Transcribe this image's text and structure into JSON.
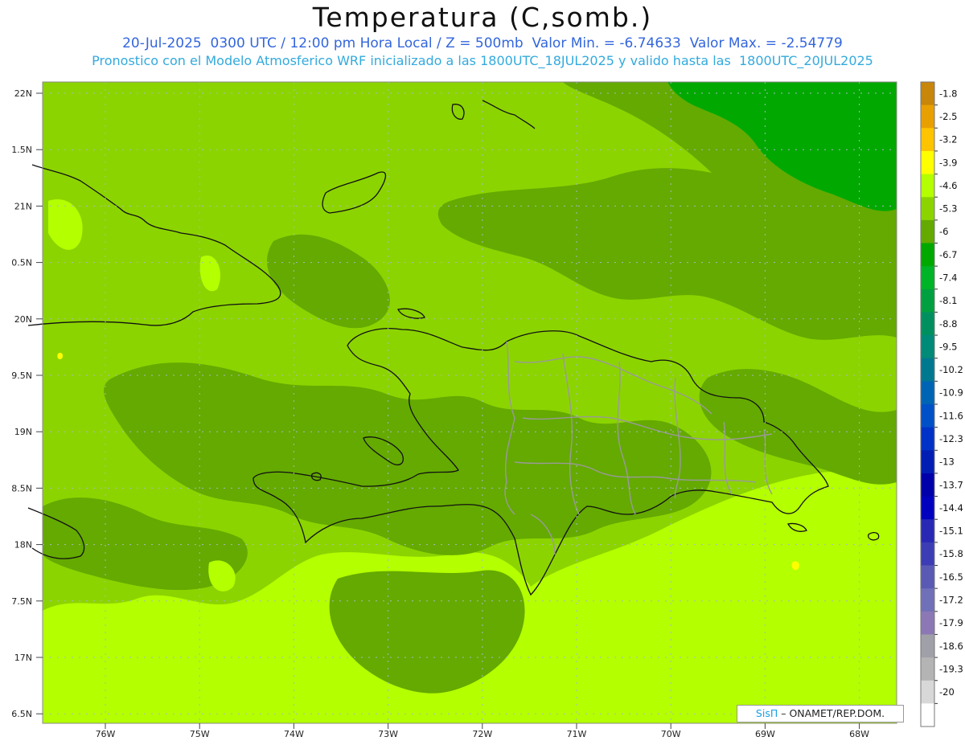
{
  "title": "Temperatura (C,somb.)",
  "subtitle_line1": "20-Jul-2025  0300 UTC / 12:00 pm Hora Local / Z = 500mb  Valor Min. = -6.74633  Valor Max. = -2.54779",
  "subtitle_line2": "Pronostico con el Modelo Atmosferico WRF inicializado a las 1800UTC_18JUL2025 y valido hasta las  1800UTC_20JUL2025",
  "credit": {
    "logo": "SisΠ",
    "text": "– ONAMET/REP.DOM."
  },
  "lat_labels": [
    "22N",
    "1.5N",
    "21N",
    "0.5N",
    "20N",
    "9.5N",
    "19N",
    "8.5N",
    "18N",
    "7.5N",
    "17N",
    "6.5N"
  ],
  "lon_labels": [
    "76W",
    "75W",
    "74W",
    "73W",
    "72W",
    "71W",
    "70W",
    "69W",
    "68W"
  ],
  "colorbar": [
    {
      "label": "-1.8",
      "color": "#c8860a"
    },
    {
      "label": "-2.5",
      "color": "#e8a000"
    },
    {
      "label": "-3.2",
      "color": "#ffc400"
    },
    {
      "label": "-3.9",
      "color": "#ffff00"
    },
    {
      "label": "-4.6",
      "color": "#b4ff00"
    },
    {
      "label": "-5.3",
      "color": "#8cd400"
    },
    {
      "label": "-6",
      "color": "#64aa00"
    },
    {
      "label": "-6.7",
      "color": "#00a800"
    },
    {
      "label": "-7.4",
      "color": "#00b428"
    },
    {
      "label": "-8.1",
      "color": "#00a040"
    },
    {
      "label": "-8.8",
      "color": "#009060"
    },
    {
      "label": "-9.5",
      "color": "#008a78"
    },
    {
      "label": "-10.2",
      "color": "#007890"
    },
    {
      "label": "-10.9",
      "color": "#0064b4"
    },
    {
      "label": "-11.6",
      "color": "#0050c8"
    },
    {
      "label": "-12.3",
      "color": "#0032c8"
    },
    {
      "label": "-13",
      "color": "#001eb4"
    },
    {
      "label": "-13.7",
      "color": "#0000aa"
    },
    {
      "label": "-14.4",
      "color": "#0000be"
    },
    {
      "label": "-15.1",
      "color": "#2828b4"
    },
    {
      "label": "-15.8",
      "color": "#3c3cb4"
    },
    {
      "label": "-16.5",
      "color": "#5a5ab4"
    },
    {
      "label": "-17.2",
      "color": "#7070b8"
    },
    {
      "label": "-17.9",
      "color": "#8c78b4"
    },
    {
      "label": "-18.6",
      "color": "#a0a0a8"
    },
    {
      "label": "-19.3",
      "color": "#b4b4b4"
    },
    {
      "label": "-20",
      "color": "#d8d8d8"
    },
    {
      "label": "",
      "color": "#ffffff"
    }
  ],
  "fill_colors": {
    "light": "#b4ff00",
    "mid": "#8cd400",
    "dark": "#64aa00",
    "deep": "#00a800",
    "warm": "#ffff00"
  }
}
